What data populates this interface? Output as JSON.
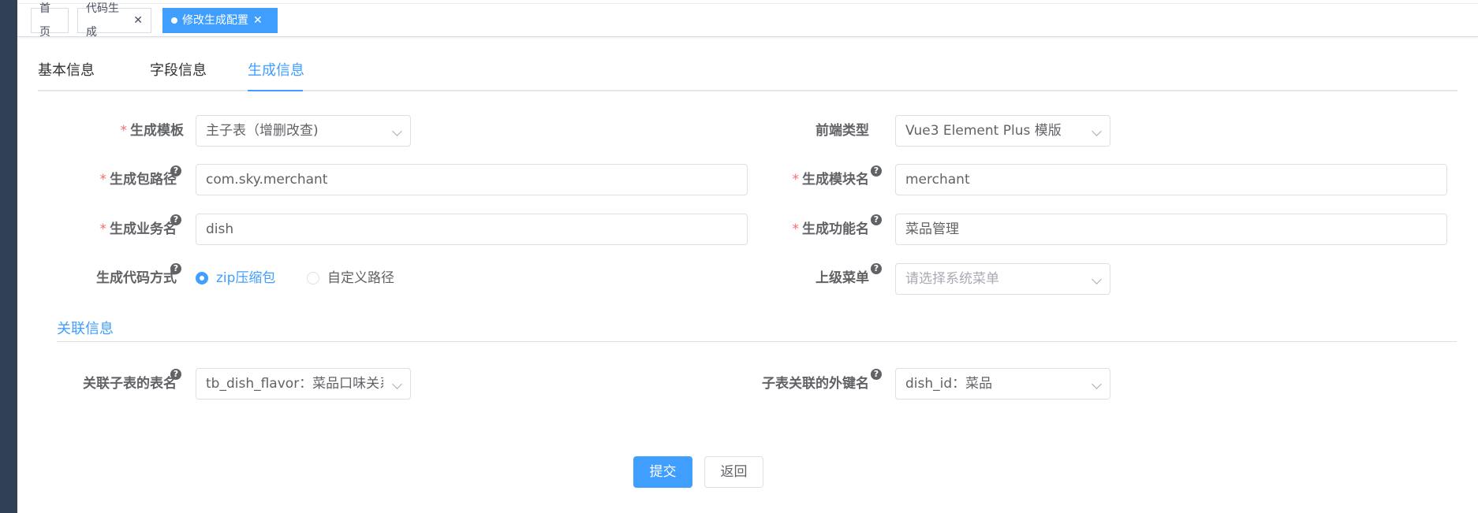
{
  "tags": [
    {
      "label": "首页"
    },
    {
      "label": "代码生成"
    },
    {
      "label": "修改生成配置"
    }
  ],
  "tabs": [
    {
      "label": "基本信息"
    },
    {
      "label": "字段信息"
    },
    {
      "label": "生成信息"
    }
  ],
  "form": {
    "tpl_category": {
      "label": "生成模板",
      "value": "主子表（增删改查)"
    },
    "frontend_type": {
      "label": "前端类型",
      "value": "Vue3 Element Plus 模版"
    },
    "package_name": {
      "label": "生成包路径",
      "value": "com.sky.merchant"
    },
    "module_name": {
      "label": "生成模块名",
      "value": "merchant"
    },
    "business_name": {
      "label": "生成业务名",
      "value": "dish"
    },
    "function_name": {
      "label": "生成功能名",
      "value": "菜品管理"
    },
    "gen_type": {
      "label": "生成代码方式",
      "option_zip": "zip压缩包",
      "option_custom": "自定义路径"
    },
    "parent_menu": {
      "label": "上级菜单",
      "placeholder": "请选择系统菜单"
    }
  },
  "relation": {
    "section_title": "关联信息",
    "sub_table": {
      "label": "关联子表的表名",
      "value": "tb_dish_flavor：菜品口味关系表"
    },
    "sub_fk": {
      "label": "子表关联的外键名",
      "value": "dish_id：菜品"
    }
  },
  "buttons": {
    "submit": "提交",
    "back": "返回"
  },
  "colors": {
    "primary": "#409eff",
    "required": "#f56c6c",
    "sidebar": "#304156"
  }
}
